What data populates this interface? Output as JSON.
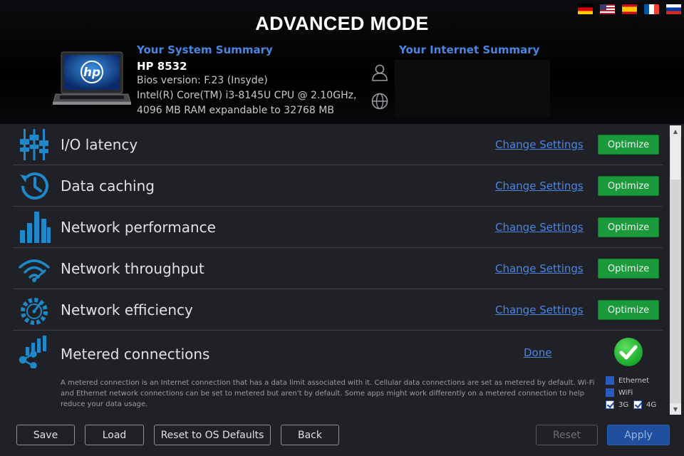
{
  "header": {
    "title": "ADVANCED MODE",
    "flags": [
      "de-flag-icon",
      "us-flag-icon",
      "es-flag-icon",
      "fr-flag-icon",
      "ru-flag-icon"
    ]
  },
  "system": {
    "heading": "Your System Summary",
    "model": "HP 8532",
    "bios": "Bios version: F.23 (Insyde)",
    "cpu": "Intel(R) Core(TM) i3-8145U CPU @ 2.10GHz,",
    "ram": "4096 MB RAM expandable to 32768 MB"
  },
  "internet": {
    "heading": "Your Internet Summary"
  },
  "rows": [
    {
      "label": "I/O latency",
      "icon": "io-latency-icon",
      "change": "Change Settings",
      "action": "Optimize"
    },
    {
      "label": "Data caching",
      "icon": "data-caching-icon",
      "change": "Change Settings",
      "action": "Optimize"
    },
    {
      "label": "Network performance",
      "icon": "network-performance-icon",
      "change": "Change Settings",
      "action": "Optimize"
    },
    {
      "label": "Network throughput",
      "icon": "network-throughput-icon",
      "change": "Change Settings",
      "action": "Optimize"
    },
    {
      "label": "Network efficiency",
      "icon": "network-efficiency-icon",
      "change": "Change Settings",
      "action": "Optimize"
    }
  ],
  "metered": {
    "label": "Metered connections",
    "done": "Done",
    "description": "A metered connection is an Internet connection that has a data limit associated with it. Cellular data connections are set as metered by default. Wi-Fi and Ethernet network connections can be set to metered but aren't by default. Some apps might work differently on a metered connection to help reduce your data usage.",
    "ethernet": "Ethernet",
    "wifi": "WiFi",
    "g3": "3G",
    "g4": "4G"
  },
  "buttons": {
    "save": "Save",
    "load": "Load",
    "reset_os": "Reset to OS Defaults",
    "back": "Back",
    "reset": "Reset",
    "apply": "Apply"
  },
  "colors": {
    "accent": "#4a86e0",
    "optimize": "#1a9a3a",
    "icon_blue": "#1e88c8"
  }
}
